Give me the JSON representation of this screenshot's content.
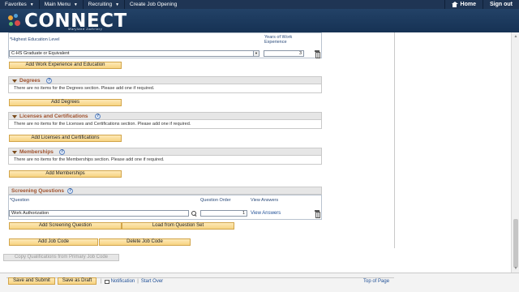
{
  "topnav": {
    "favorites": "Favorites",
    "main_menu": "Main Menu",
    "recruiting": "Recruiting",
    "create_job_opening": "Create Job Opening",
    "home": "Home",
    "sign_out": "Sign out"
  },
  "brand": {
    "logo_text": "CONNECT",
    "logo_sub": "Maryland Judiciary"
  },
  "education": {
    "col_level": "*Highest Education Level",
    "col_years": "Years of Work Experience",
    "level_value": "C-HS Graduate or Equivalent",
    "years_value": "3"
  },
  "buttons": {
    "add_work": "Add Work Experience and Education",
    "add_degrees": "Add Degrees",
    "add_licenses": "Add Licenses and Certifications",
    "add_memberships": "Add Memberships",
    "add_screening": "Add Screening Question",
    "load_question_set": "Load from Question Set",
    "add_job_code": "Add Job Code",
    "delete_job_code": "Delete Job Code",
    "copy_qualifications": "Copy Qualifications from Primary Job Code",
    "save_submit": "Save and Submit",
    "save_draft": "Save as Draft"
  },
  "sections": {
    "degrees": {
      "title": "Degrees",
      "msg": "There are no items for the Degrees section.  Please add one if required."
    },
    "licenses": {
      "title": "Licenses and Certifications",
      "msg": "There are no items for the Licenses and Certifications section.  Please add one if required."
    },
    "memberships": {
      "title": "Memberships",
      "msg": "There are no items for the Memberships section.  Please add one if required."
    }
  },
  "screening": {
    "title": "Screening Questions",
    "col_question": "*Question",
    "col_order": "Question Order",
    "col_answers": "View Answers",
    "question_value": "Work Authorization",
    "order_value": "1",
    "answers_link": "View Answers"
  },
  "footer": {
    "notification": "Notification",
    "separator": "|",
    "start_over": "Start Over",
    "top_of_page": "Top of Page"
  },
  "icons": {
    "help": "?",
    "select_arrow": "▼",
    "nav_caret": "▼"
  }
}
